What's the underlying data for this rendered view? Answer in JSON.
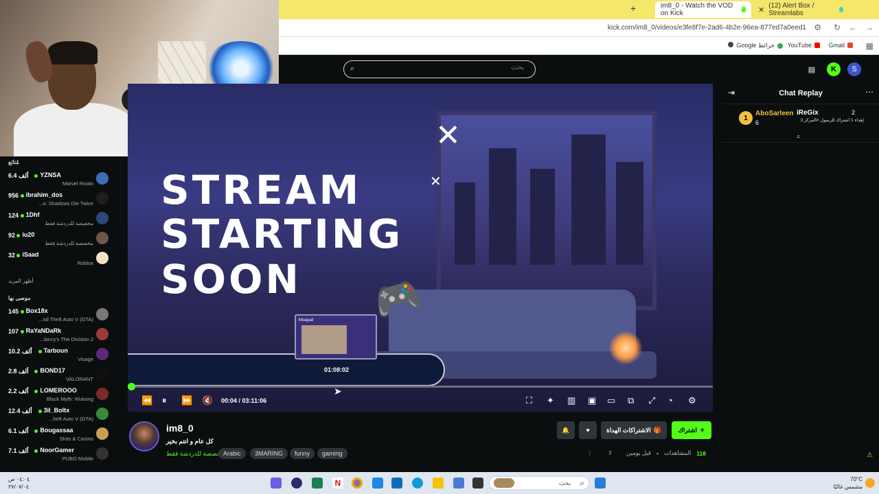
{
  "browser": {
    "tabs": [
      {
        "label": "im8_0 - Watch the VOD on Kick",
        "active": true
      },
      {
        "label": "(12) Alert Box / Streamlabs",
        "active": false
      }
    ],
    "url": "kick.com/im8_0/videos/e3fe8f7e-2ad6-4b2e-96ea-877ed7a0eed1",
    "bookmarks": [
      "Gmail",
      "YouTube",
      "Google خرائط"
    ]
  },
  "header": {
    "search_placeholder": "بحث"
  },
  "sidebar": {
    "section_recommended": "مُتابَع",
    "show_more": "أظهر المزيد",
    "section_suggested": "موصى بها",
    "followed": [
      {
        "count": "6.4 ألف",
        "name": "YZNSA",
        "sub": "Marvel Rivals",
        "avatar_color": "#3b6fb5"
      },
      {
        "count": "956",
        "name": "ibrahim_dos",
        "sub": "...o: Shadows Die Twice",
        "avatar_color": "#1e1e1e"
      },
      {
        "count": "124",
        "name": "1Dhf",
        "sub": "مخصصة للدردشة فقط",
        "avatar_color": "#2b4a7a"
      },
      {
        "count": "92",
        "name": "iu20",
        "sub": "مخصصة للدردشة فقط",
        "avatar_color": "#6b5a4a"
      },
      {
        "count": "32",
        "name": "iSaad",
        "sub": "Roblox",
        "avatar_color": "#f4e2c4"
      }
    ],
    "suggested": [
      {
        "count": "145",
        "name": "Box18x",
        "sub": "...nd Theft Auto V (GTA)",
        "avatar_color": "#777"
      },
      {
        "count": "107",
        "name": "RaYaNDaRk",
        "sub": "...lancy's The Division 2",
        "avatar_color": "#9a3a3a"
      },
      {
        "count": "10.2 ألف",
        "name": "Tarboun",
        "sub": "Visage",
        "avatar_color": "#5a2a7a"
      },
      {
        "count": "2.8 ألف",
        "name": "BOND17",
        "sub": "VALORANT",
        "avatar_color": "#111"
      },
      {
        "count": "2.2 ألف",
        "name": "LOMEROOO",
        "sub": "Black Myth: Wukong",
        "avatar_color": "#7a2a2a"
      },
      {
        "count": "12.4 ألف",
        "name": "3il_Boltx",
        "sub": "...heft Auto V (GTA)",
        "avatar_color": "#3a8a3a"
      },
      {
        "count": "6.1 ألف",
        "name": "Bougassaa",
        "sub": "Slots & Casino",
        "avatar_color": "#c8a050"
      },
      {
        "count": "7.1 ألف",
        "name": "NoorGamer",
        "sub": "PUBG Mobile",
        "avatar_color": "#333"
      }
    ]
  },
  "video": {
    "overlay_lines": [
      "STREAM",
      "STARTING",
      "SOON"
    ],
    "preview_label": "Moayad",
    "preview_time": "01:08:02",
    "current_time": "00:04",
    "duration": "03:11:06",
    "progress": 0.0003
  },
  "chat": {
    "title": "Chat Replay",
    "gift": {
      "rank": "1",
      "gifter": "AboSarleen",
      "gifter_count": "6",
      "recipient": "iReGix",
      "recipient_count": "2",
      "message": "إهداء 1 اشتراك للرسول #المركز 3"
    }
  },
  "channel": {
    "name": "im8_0",
    "title": "كل عام و انتم بخير",
    "category": "مخصصة للدردشة فقط",
    "tags": [
      "Arabic",
      "3MARING",
      "funny",
      "gaming"
    ],
    "subscribe_label": "اشتراك",
    "gift_subs_label": "الاشتراكات الهداة",
    "viewers_label": "المشاهدات",
    "viewers": "118",
    "time_ago": "قبل يومين"
  },
  "taskbar": {
    "search_placeholder": "بحث",
    "weather_temp": "70°C",
    "weather_desc": "مشمس غالبًا",
    "clock_time": "٠٤:٠٤ ص",
    "clock_date": "٢٧/٠٧/٠٤"
  }
}
